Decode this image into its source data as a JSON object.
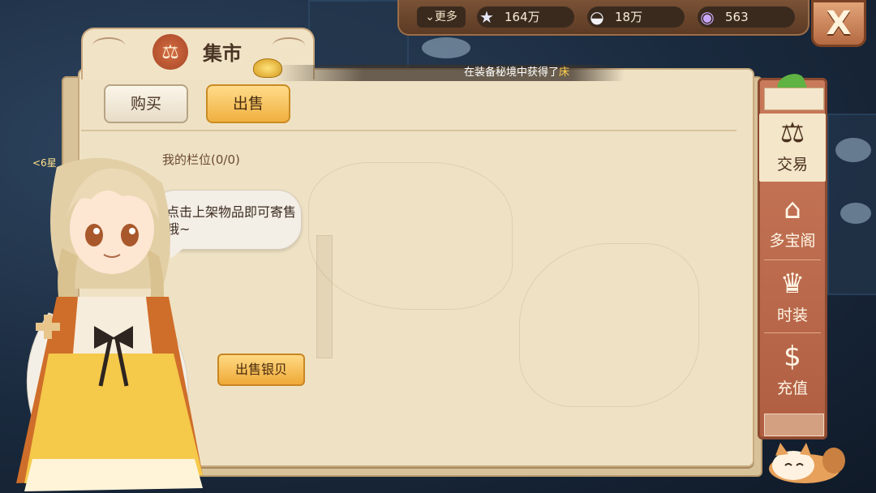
{
  "topbar": {
    "more_label": "更多",
    "currencies": [
      {
        "icon": "star-icon",
        "value": "164万"
      },
      {
        "icon": "shell-icon",
        "value": "18万"
      },
      {
        "icon": "nautilus-icon",
        "value": "563"
      }
    ],
    "close_label": "X"
  },
  "title": {
    "label": "集市",
    "icon": "scale-icon"
  },
  "notice": {
    "text": "在装备秘境中获得了",
    "highlight": "床"
  },
  "tabs": {
    "buy": "购买",
    "sell": "出售"
  },
  "slots_label": "我的栏位(0/0)",
  "npc_bubble": "点击上架物品即可寄售哦~",
  "sell_silver_label": "出售银贝",
  "sidebar": {
    "items": [
      {
        "label": "交易",
        "icon": "trade-scale-icon",
        "active": true
      },
      {
        "label": "多宝阁",
        "icon": "treasure-pavilion-icon",
        "active": false
      },
      {
        "label": "时装",
        "icon": "fashion-icon",
        "active": false
      },
      {
        "label": "充值",
        "icon": "dollar-icon",
        "active": false
      }
    ]
  },
  "player_tag": "<6星",
  "colors": {
    "accent": "#f0b040",
    "panel": "#efe2c4",
    "sidebar": "#b05e42"
  }
}
